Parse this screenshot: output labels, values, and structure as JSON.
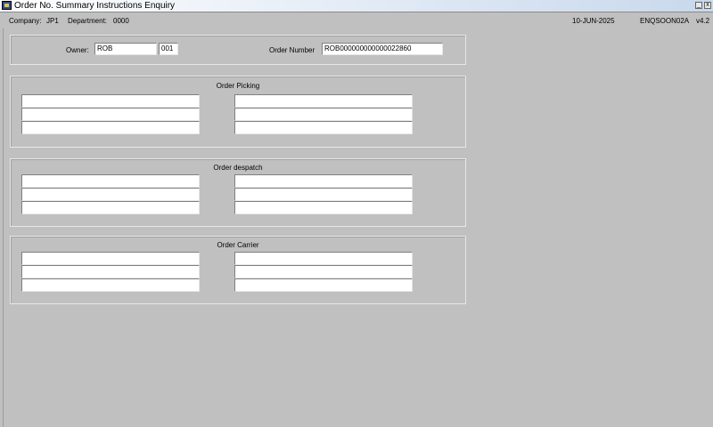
{
  "window": {
    "title": "Order No. Summary Instructions Enquiry",
    "icon": "app-icon",
    "minimize": "_",
    "close": "x"
  },
  "header": {
    "company_label": "Company:",
    "company_value": "JP1",
    "department_label": "Department:",
    "department_value": "0000",
    "date": "10-JUN-2025",
    "program": "ENQSOON02A",
    "version": "v4.2"
  },
  "criteria": {
    "owner_label": "Owner:",
    "owner_code": "ROB",
    "owner_sub": "001",
    "order_number_label": "Order Number",
    "order_number": "ROB000000000000022860"
  },
  "sections": [
    {
      "title": "Order Picking",
      "left": [
        "",
        "",
        ""
      ],
      "right": [
        "",
        "",
        ""
      ]
    },
    {
      "title": "Order despatch",
      "left": [
        "",
        "",
        ""
      ],
      "right": [
        "",
        "",
        ""
      ]
    },
    {
      "title": "Order Carrier",
      "left": [
        "",
        "",
        ""
      ],
      "right": [
        "",
        "",
        ""
      ]
    }
  ]
}
